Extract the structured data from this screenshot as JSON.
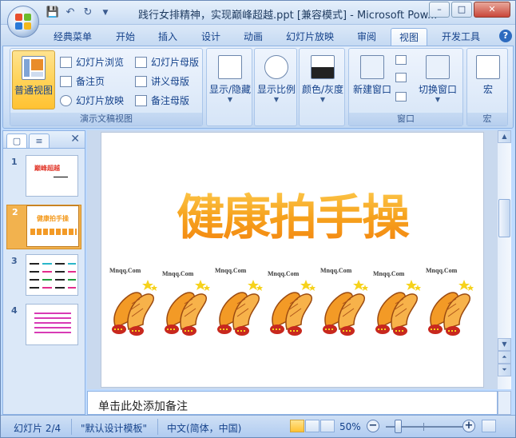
{
  "window": {
    "title": "践行女排精神，实现巅峰超越.ppt [兼容模式] - Microsoft Pow...",
    "controls": {
      "minimize": "–",
      "maximize": "□",
      "close": "✕"
    }
  },
  "qat": {
    "save_icon": "save-icon",
    "undo_icon": "undo-icon",
    "redo_icon": "redo-icon",
    "customize_icon": "chevron-down-icon"
  },
  "tabs": [
    {
      "label": "经典菜单"
    },
    {
      "label": "开始"
    },
    {
      "label": "插入"
    },
    {
      "label": "设计"
    },
    {
      "label": "动画"
    },
    {
      "label": "幻灯片放映"
    },
    {
      "label": "审阅"
    },
    {
      "label": "视图",
      "active": true
    },
    {
      "label": "开发工具"
    }
  ],
  "help_label": "?",
  "ribbon": {
    "presentation_views": {
      "group_label": "演示文稿视图",
      "normal": "普通视图",
      "slide_sorter": "幻灯片浏览",
      "notes_page": "备注页",
      "slide_show": "幻灯片放映",
      "slide_master": "幻灯片母版",
      "handout_master": "讲义母版",
      "notes_master": "备注母版"
    },
    "show_hide": "显示/隐藏",
    "zoom": "显示比例",
    "color_gray": "颜色/灰度",
    "window": {
      "group_label": "窗口",
      "new_window": "新建窗口",
      "switch_windows": "切换窗口"
    },
    "macros": {
      "group_label": "宏",
      "label": "宏"
    }
  },
  "slides_pane": {
    "close": "✕",
    "slides": [
      {
        "num": "1",
        "title": "巅峰超越"
      },
      {
        "num": "2",
        "title": "健康拍手操",
        "selected": true
      },
      {
        "num": "3",
        "title": ""
      },
      {
        "num": "4",
        "title": ""
      }
    ]
  },
  "slide": {
    "title": "健康拍手操",
    "watermark": "Mnqq.Com",
    "claps": 7
  },
  "notes": {
    "placeholder": "单击此处添加备注"
  },
  "status": {
    "slide_info": "幻灯片 2/4",
    "theme": "\"默认设计模板\"",
    "language": "中文(简体，中国)",
    "zoom": "50%",
    "zoom_out": "−",
    "zoom_in": "+"
  },
  "colors": {
    "accent_orange": "#f6a21d",
    "ribbon_blue": "#15428b"
  }
}
